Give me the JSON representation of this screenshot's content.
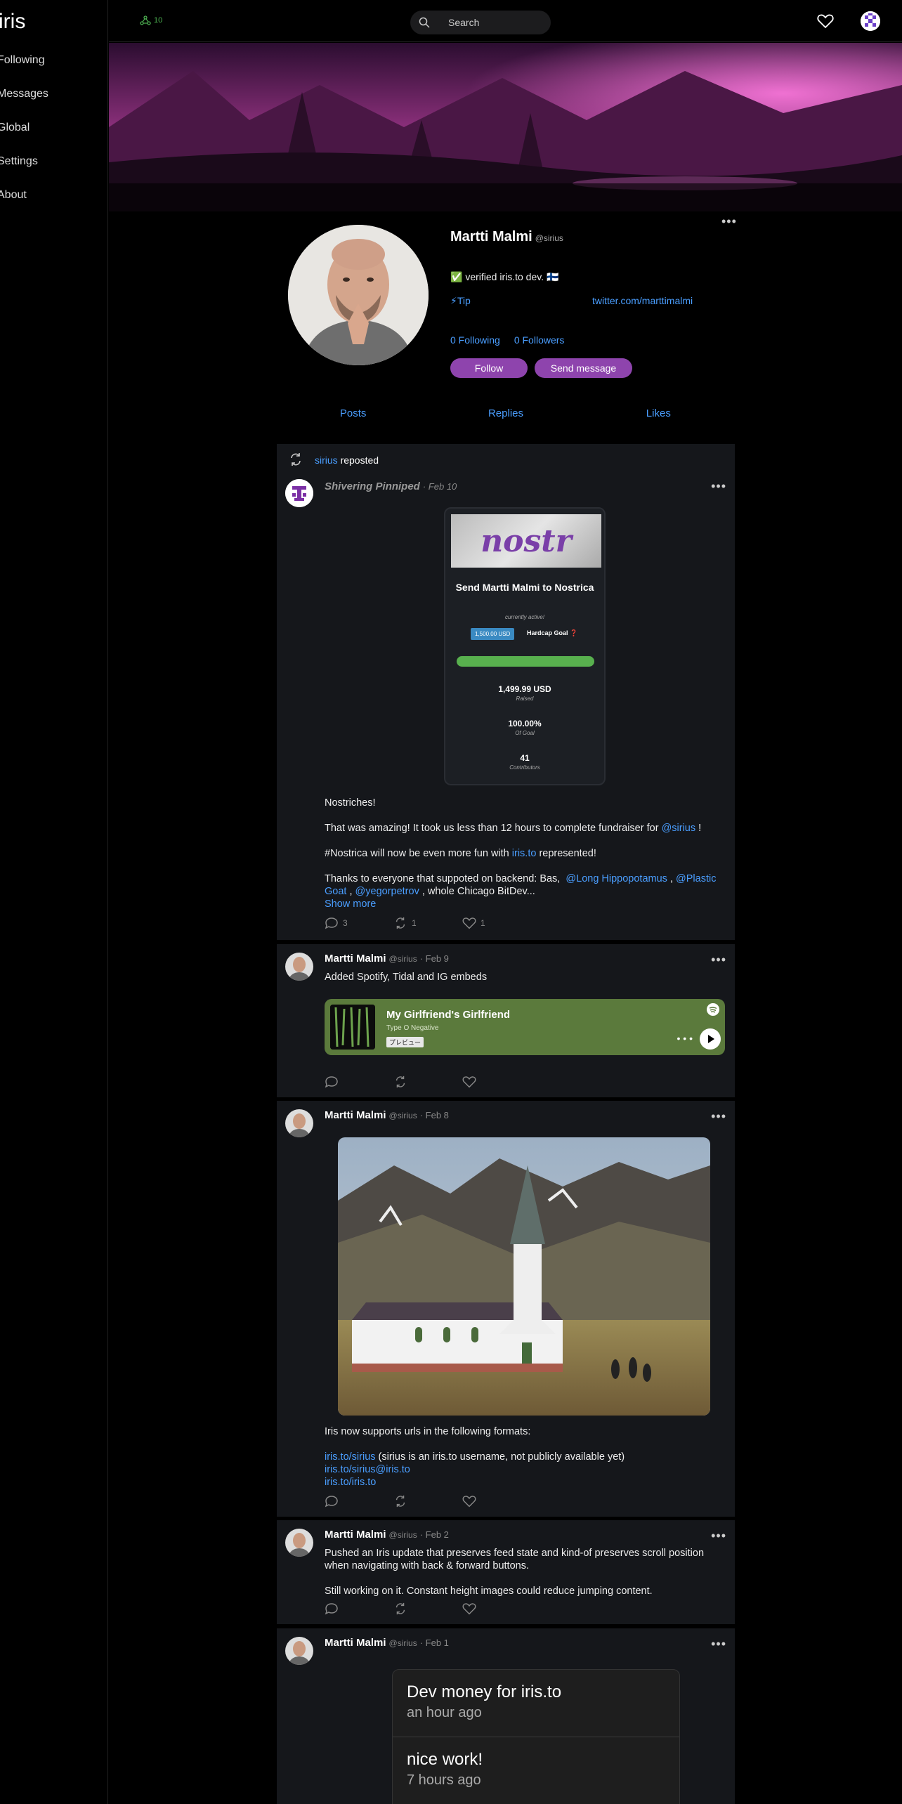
{
  "app": {
    "logo": "iris"
  },
  "sidebar": {
    "items": [
      {
        "label": "Following"
      },
      {
        "label": "Messages"
      },
      {
        "label": "Global"
      },
      {
        "label": "Settings"
      },
      {
        "label": "About"
      }
    ]
  },
  "header": {
    "peers_count": "10",
    "search_placeholder": "Search"
  },
  "profile": {
    "name": "Martti Malmi",
    "handle": "@sirius",
    "bio": "✅ verified iris.to dev. 🇫🇮",
    "tip_label": "⚡Tip",
    "website": "twitter.com/marttimalmi",
    "following": "0 Following",
    "followers": "0 Followers",
    "follow_label": "Follow",
    "message_label": "Send message"
  },
  "tabs": [
    {
      "label": "Posts"
    },
    {
      "label": "Replies"
    },
    {
      "label": "Likes"
    }
  ],
  "posts": [
    {
      "repost_user": "sirius",
      "repost_label": "reposted",
      "author": "Shivering Pinniped",
      "date": "· Feb 10",
      "fund": {
        "logo": "nostr",
        "title": "Send Martti Malmi to Nostrica",
        "subtitle": "currently active!",
        "chip": "1,500.00 USD",
        "goal_label": "Hardcap Goal ❓",
        "progress": 1.0,
        "raised_value": "1,499.99 USD",
        "raised_label": "Raised",
        "pct_value": "100.00%",
        "pct_label": "Of Goal",
        "contrib_value": "41",
        "contrib_label": "Contributors"
      },
      "p1": "Nostriches!",
      "p2_pre": "That was amazing! It took us less than 12 hours to complete fundraiser for",
      "p2_link": "@sirius",
      "p2_post": "!",
      "p3_pre": "#Nostrica will now be even more fun with",
      "p3_link": "iris.to",
      "p3_post": "represented!",
      "p4_pre": "Thanks to everyone that suppoted on backend: Bas,",
      "p4_link1": "@Long Hippopotamus",
      "p4_sep1": ",",
      "p4_link2": "@Plastic Goat",
      "p4_sep2": ",",
      "p4_link3": "@yegorpetrov",
      "p4_post": ", whole Chicago BitDev...",
      "show_more": "Show more",
      "replies": "3",
      "reposts": "1",
      "likes": "1"
    },
    {
      "author": "Martti Malmi",
      "handle": "@sirius",
      "date": "· Feb 9",
      "text": "Added Spotify, Tidal and IG embeds",
      "spotify": {
        "title": "My Girlfriend's Girlfriend",
        "artist": "Type O Negative",
        "badge": "プレビュー",
        "dots": "• • •"
      }
    },
    {
      "author": "Martti Malmi",
      "handle": "@sirius",
      "date": "· Feb 8",
      "text": "Iris now supports urls in the following formats:",
      "link1": "iris.to/sirius",
      "link1_note": "(sirius is an iris.to username, not publicly available yet)",
      "link2": "iris.to/sirius@iris.to",
      "link3": "iris.to/iris.to"
    },
    {
      "author": "Martti Malmi",
      "handle": "@sirius",
      "date": "· Feb 2",
      "text1": "Pushed an Iris update that preserves feed state and kind-of preserves scroll position when navigating with back & forward buttons.",
      "text2": "Still working on it. Constant height images could reduce jumping content."
    },
    {
      "author": "Martti Malmi",
      "handle": "@sirius",
      "date": "· Feb 1",
      "cards": [
        {
          "title": "Dev money for iris.to",
          "sub": "an hour ago"
        },
        {
          "title": "nice work!",
          "sub": "7 hours ago"
        }
      ]
    }
  ],
  "colors": {
    "accent": "#8e44ad",
    "link": "#4a9eff",
    "post_bg": "#15171b",
    "spotify_bg": "#5b7a3c"
  }
}
